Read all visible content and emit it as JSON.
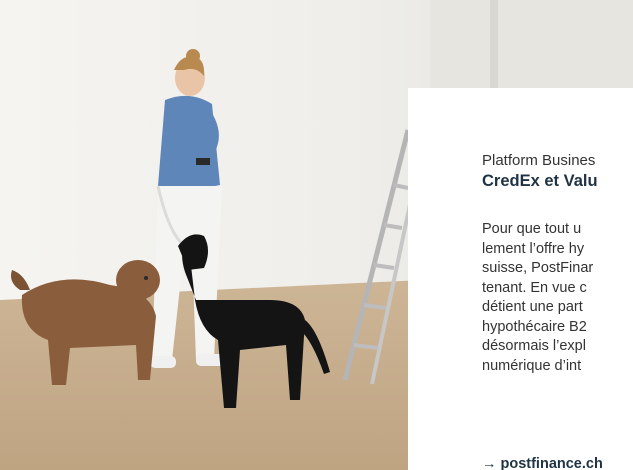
{
  "card": {
    "eyebrow": "Platform Busines",
    "headline": "CredEx et Valu",
    "body_lines": [
      "Pour que tout u",
      "lement l’offre hy",
      "suisse, PostFinar",
      "tenant. En vue c",
      "détient une part",
      "hypothécaire B2",
      "désormais l’expl",
      "numérique d’int"
    ],
    "link_arrow": "→",
    "link_text": "postfinance.ch"
  },
  "colors": {
    "headline": "#1f3344",
    "body": "#333333",
    "wall": "#f1f0ec",
    "floor": "#c4ab8c"
  },
  "photo": {
    "description_icons": [
      "woman-figure",
      "brown-dog",
      "black-dog",
      "ladder"
    ]
  }
}
